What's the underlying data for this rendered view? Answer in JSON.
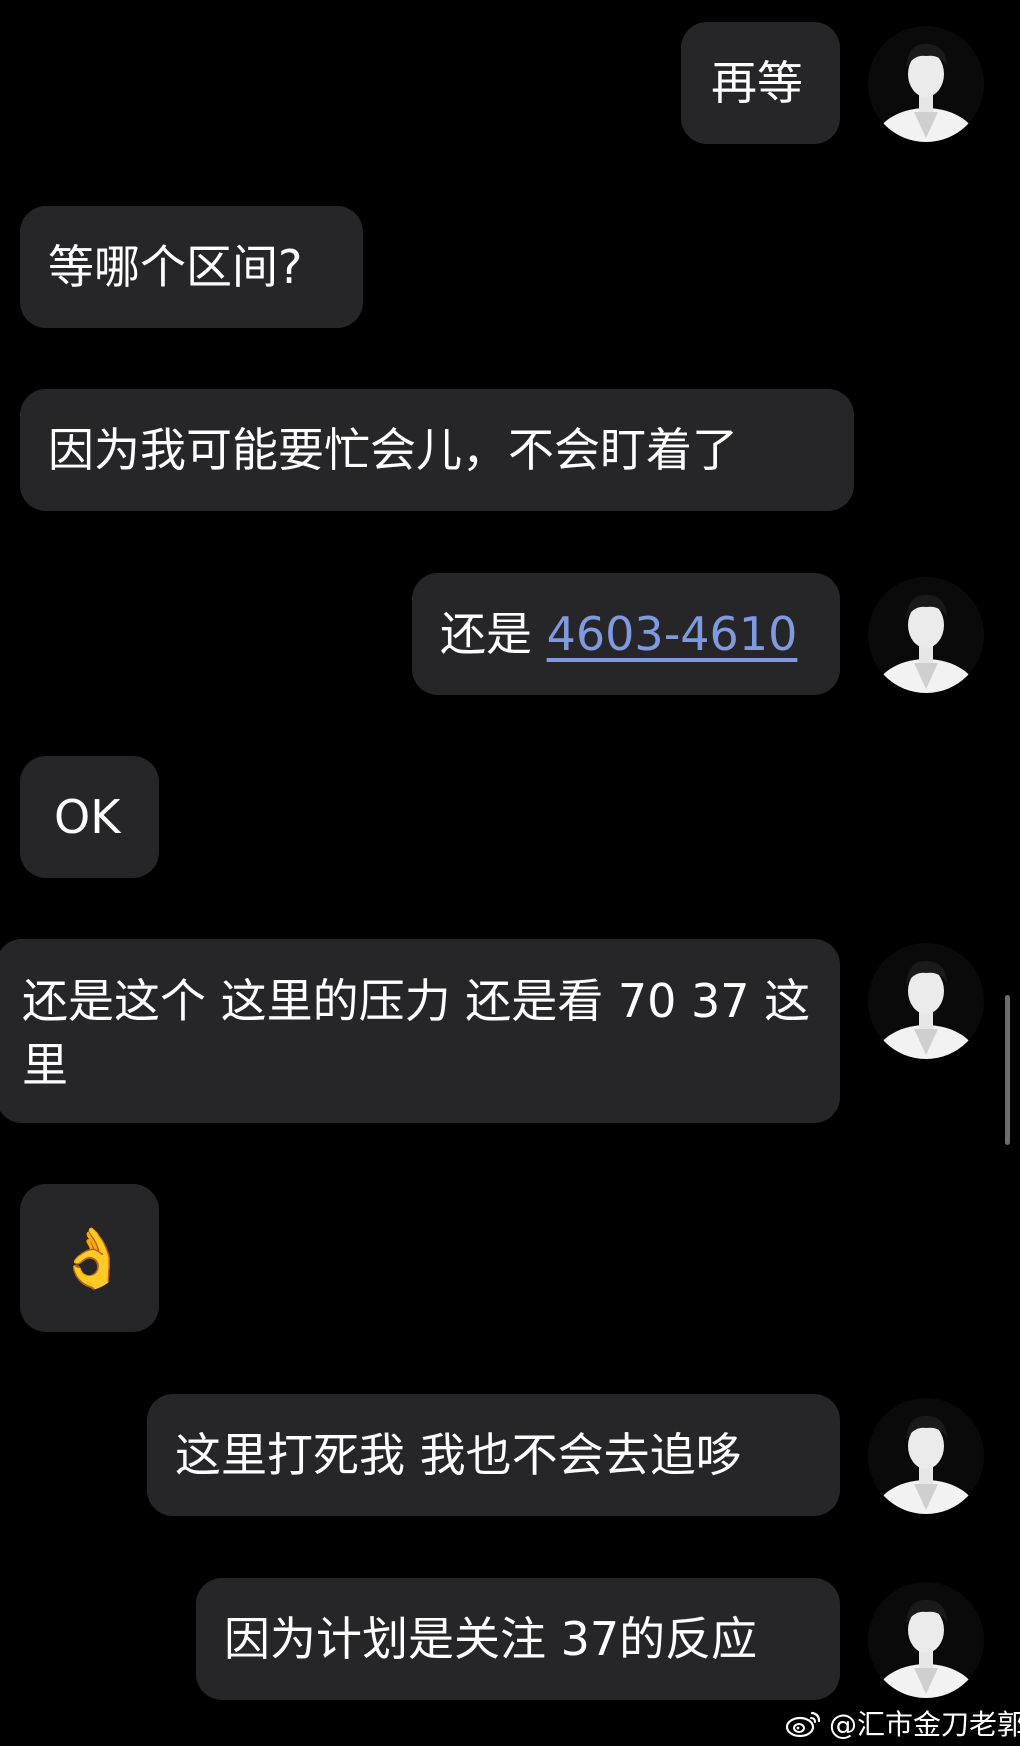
{
  "messages": [
    {
      "side": "right",
      "text": "再等"
    },
    {
      "side": "left",
      "text": "等哪个区间?"
    },
    {
      "side": "left",
      "text": "因为我可能要忙会儿，不会盯着了"
    },
    {
      "side": "right",
      "text_prefix": "还是 ",
      "link": "4603-4610"
    },
    {
      "side": "left",
      "text": "OK"
    },
    {
      "side": "right",
      "text": "还是这个 这里的压力 还是看 70 37 这里"
    },
    {
      "side": "left",
      "text": "👌"
    },
    {
      "side": "right",
      "text": "这里打死我 我也不会去追哆"
    },
    {
      "side": "right",
      "text": "因为计划是关注 37的反应"
    }
  ],
  "watermark": {
    "text": "@汇市金刀老郭",
    "icon": "weibo-icon"
  },
  "colors": {
    "background": "#000000",
    "bubble": "#262628",
    "text": "#ffffff",
    "link": "#7f9ae0",
    "scrollbar": "#6e6e72"
  }
}
